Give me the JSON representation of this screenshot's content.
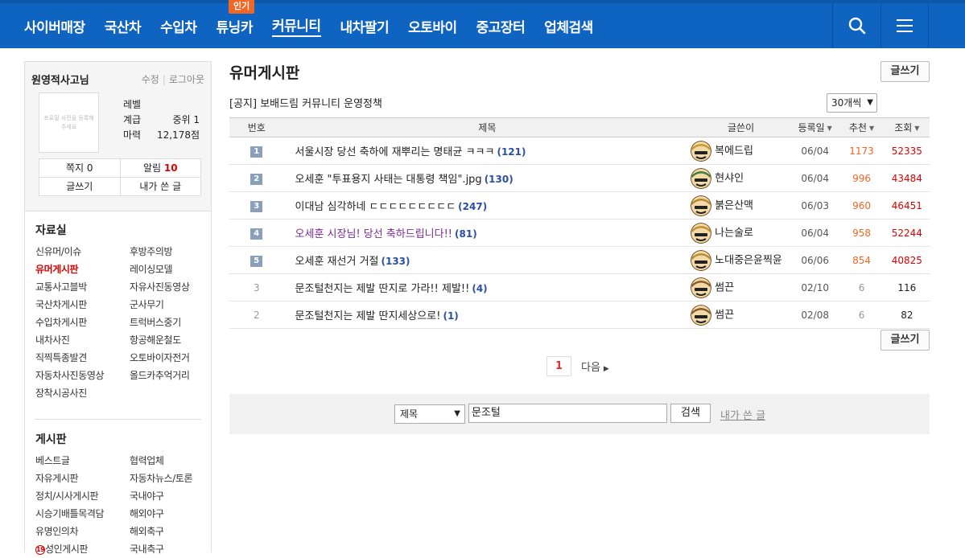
{
  "nav": {
    "items": [
      "사이버매장",
      "국산차",
      "수입차",
      "튜닝카",
      "커뮤니티",
      "내차팔기",
      "오토바이",
      "중고장터",
      "업체검색"
    ],
    "active_index": 4,
    "hot_badge": "인기"
  },
  "icons": {
    "search": "search-icon",
    "menu": "hamburger-menu-icon"
  },
  "profile": {
    "username": "원영적사고님",
    "edit": "수정",
    "logout": "로그아웃",
    "photo_placeholder": "프로필 사진을 등록해주세요",
    "level_label": "레벨",
    "level_value": "",
    "grade_label": "계급",
    "grade_value": "중위 1",
    "power_label": "마력",
    "power_value": "12,178점",
    "note_label": "쪽지 0",
    "alarm_label": "알림",
    "alarm_count": "10",
    "write_label": "글쓰기",
    "my_posts_label": "내가 쓴 글"
  },
  "sidebar": {
    "section1_title": "자료실",
    "section1_links": [
      "신유머/이슈",
      "후방주의방",
      "유머게시판",
      "레이싱모델",
      "교통사고블박",
      "자유사진동영상",
      "국산차게시판",
      "군사무기",
      "수입차게시판",
      "트럭버스중기",
      "내차사진",
      "항공해운철도",
      "직찍특종발견",
      "오토바이자전거",
      "자동차사진동영상",
      "올드카추억거리",
      "장착시공사진"
    ],
    "section1_current": "유머게시판",
    "section2_title": "게시판",
    "section2_links": [
      "베스트글",
      "협력업체",
      "자유게시판",
      "자동차뉴스/토론",
      "정치/시사게시판",
      "국내야구",
      "시승기배틀목격담",
      "해외야구",
      "유명인의차",
      "해외축구",
      "성인게시판",
      "국내축구"
    ],
    "adult_badge": "19"
  },
  "board": {
    "title": "유머게시판",
    "notice": "[공지] 보배드림 커뮤니티 운영정책",
    "per_page": "30개씩",
    "write_button": "글쓰기",
    "columns": {
      "num": "번호",
      "subject": "제목",
      "writer": "글쓴이",
      "date": "등록일",
      "rec": "추천",
      "views": "조회"
    },
    "rows": [
      {
        "num": "1",
        "rank": true,
        "subject": "서울시장 당선 축하에 재뿌리는 명태균 ㅋㅋㅋ",
        "comments": "(121)",
        "writer": "복에드립",
        "date": "06/04",
        "rec": "1173",
        "views": "52335",
        "visited": false,
        "avatar_color": "#c89a2a"
      },
      {
        "num": "2",
        "rank": true,
        "subject": "오세훈 \"투표용지 사태는 대통령 책임\".jpg",
        "comments": "(130)",
        "writer": "현샤인",
        "date": "06/04",
        "rec": "996",
        "views": "43484",
        "visited": false,
        "avatar_color": "#3a7d3a"
      },
      {
        "num": "3",
        "rank": true,
        "subject": "이대남 심각하네 ㄷㄷㄷㄷㄷㄷㄷㄷㄷ",
        "comments": "(247)",
        "writer": "붉은산맥",
        "date": "06/03",
        "rev": "",
        "rec": "960",
        "views": "46451",
        "visited": false,
        "avatar_color": "#b8862a"
      },
      {
        "num": "4",
        "rank": true,
        "subject": "오세훈 시장님! 당선 축하드립니다!!",
        "comments": "(81)",
        "writer": "나는술로",
        "date": "06/04",
        "rec": "958",
        "views": "52244",
        "visited": true,
        "avatar_color": "#c0902c"
      },
      {
        "num": "5",
        "rank": true,
        "subject": "오세훈 재선거 거절",
        "comments": "(133)",
        "writer": "노대중은윤찍윤",
        "date": "06/06",
        "rec": "854",
        "views": "40825",
        "visited": false,
        "avatar_color": "#b98c30"
      },
      {
        "num": "3",
        "rank": false,
        "subject": "문조털천지는 제발 딴지로 가라!! 제발!!",
        "comments": "(4)",
        "writer": "썸끈",
        "date": "02/10",
        "rec": "6",
        "views": "116",
        "visited": false,
        "avatar_color": "#c9a050"
      },
      {
        "num": "2",
        "rank": false,
        "subject": "문조털천지는 제발 딴지세상으로!",
        "comments": "(1)",
        "writer": "썸끈",
        "date": "02/08",
        "rec": "6",
        "views": "82",
        "visited": false,
        "avatar_color": "#c9a050"
      }
    ],
    "page_current": "1",
    "page_next": "다음"
  },
  "search": {
    "field": "제목",
    "query": "문조털",
    "button": "검색",
    "my_posts": "내가 쓴 글"
  },
  "colors": {
    "nav_bg": "#1064c1",
    "hot": "#f26522",
    "red": "#dd0000",
    "comment": "#2a4fa3"
  }
}
